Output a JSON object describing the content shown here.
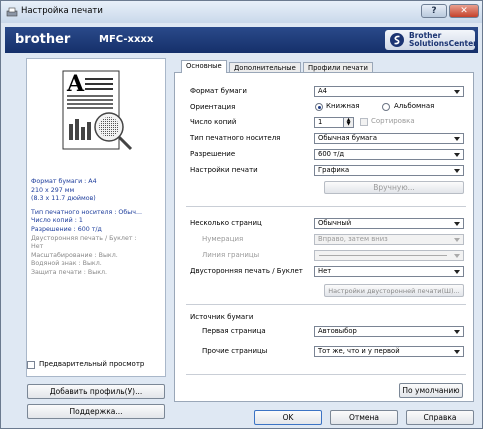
{
  "window": {
    "title": "Настройка печати",
    "help_label": "?",
    "close_label": "✕"
  },
  "brand": {
    "logo": "brother",
    "model": "MFC-xxxx",
    "solutions": "Brother\nSolutionsCenter"
  },
  "left": {
    "info": [
      {
        "text": "Формат бумаги : A4",
        "style": "blue"
      },
      {
        "text": "210 x 297 мм",
        "style": "blue"
      },
      {
        "text": "(8.3 x 11.7 дюймов)",
        "style": "blue"
      },
      {
        "text": "",
        "style": "gap"
      },
      {
        "text": "Тип печатного носителя : Обыч...",
        "style": "blue"
      },
      {
        "text": "Число копий : 1",
        "style": "blue"
      },
      {
        "text": "Разрешение : 600 т/д",
        "style": "blue"
      },
      {
        "text": "Двусторонняя печать / Буклет :",
        "style": "gray"
      },
      {
        "text": "Нет",
        "style": "gray"
      },
      {
        "text": "Масштабирование : Выкл.",
        "style": "gray"
      },
      {
        "text": "Водяной знак : Выкл.",
        "style": "gray"
      },
      {
        "text": "Защита печати : Выкл.",
        "style": "gray"
      }
    ],
    "preview_checkbox": "Предварительный просмотр",
    "add_profile": "Добавить профиль(У)...",
    "support": "Поддержка..."
  },
  "tabs": [
    "Основные",
    "Дополнительные",
    "Профили печати"
  ],
  "form": {
    "paper_size_label": "Формат бумаги",
    "paper_size_value": "A4",
    "orientation_label": "Ориентация",
    "portrait_label": "Книжная",
    "landscape_label": "Альбомная",
    "copies_label": "Число копий",
    "copies_value": "1",
    "collate_label": "Сортировка",
    "media_label": "Тип печатного носителя",
    "media_value": "Обычная бумага",
    "resolution_label": "Разрешение",
    "resolution_value": "600 т/д",
    "print_settings_label": "Настройки печати",
    "print_settings_value": "Графика",
    "manual_button": "Вручную...",
    "multiple_pages_label": "Несколько страниц",
    "multiple_pages_value": "Обычный",
    "page_order_label": "Нумерация",
    "page_order_value": "Вправо, затем вниз",
    "border_label": "Линия границы",
    "border_value": "",
    "duplex_label": "Двусторонняя печать / Буклет",
    "duplex_value": "Нет",
    "duplex_settings_button": "Настройки двусторонней печати(Ш)...",
    "paper_source_label": "Источник бумаги",
    "first_page_label": "Первая страница",
    "first_page_value": "Автовыбор",
    "other_pages_label": "Прочие страницы",
    "other_pages_value": "Тот же, что и у первой",
    "default_button": "По умолчанию"
  },
  "footer": {
    "ok": "OK",
    "cancel": "Отмена",
    "help": "Справка"
  }
}
